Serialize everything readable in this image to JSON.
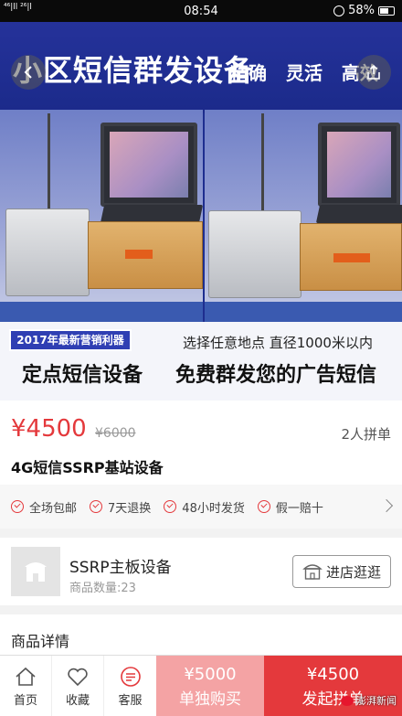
{
  "status_bar": {
    "signal": "⁴⁶|ll ²⁶|l",
    "time": "08:54",
    "battery": "58%"
  },
  "hero": {
    "title": "小区短信群发设备",
    "tags": "精确 灵活 高效",
    "badge": "2017年最新营销利器",
    "subtitle_left": "定点短信设备",
    "subtitle_right_top": "选择任意地点 直径1000米以内",
    "subtitle_right_big": "免费群发您的广告短信"
  },
  "product": {
    "price": "¥4500",
    "original_price": "¥6000",
    "group_size": "2人拼单",
    "name": "4G短信SSRP基站设备"
  },
  "guarantees": [
    "全场包邮",
    "7天退换",
    "48小时发货",
    "假一赔十"
  ],
  "shop": {
    "name": "SSRP主板设备",
    "count": "商品数量:23",
    "visit_label": "进店逛逛"
  },
  "details": {
    "title": "商品详情"
  },
  "bottom_bar": {
    "home": "首页",
    "favorite": "收藏",
    "service": "客服",
    "single_price": "¥5000",
    "single_label": "单独购买",
    "group_price": "¥4500",
    "group_label": "发起拼单"
  },
  "watermark": "澎湃新闻",
  "colors": {
    "accent": "#e4393c",
    "accent_light": "#f4a3a4",
    "banner": "#1e2e8f"
  }
}
